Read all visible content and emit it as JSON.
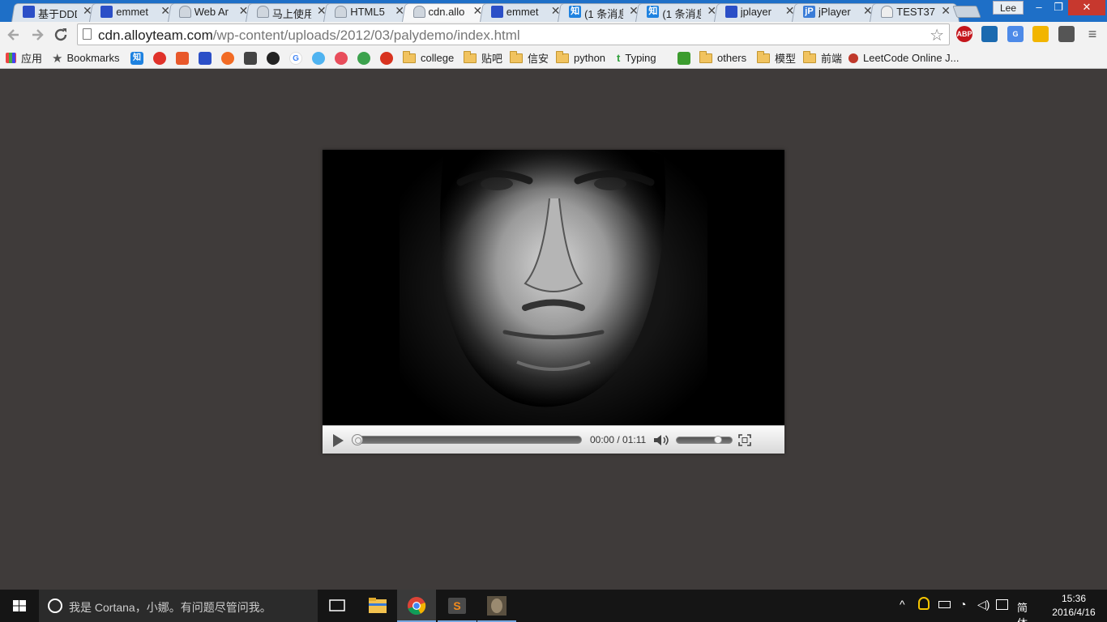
{
  "browser": {
    "tabs": [
      {
        "title": "基于DDD",
        "icon": "paw-icon",
        "active": false
      },
      {
        "title": "emmet",
        "icon": "paw-icon",
        "active": false
      },
      {
        "title": "Web Ar",
        "icon": "ghost-icon",
        "active": false
      },
      {
        "title": "马上使用",
        "icon": "ghost-icon",
        "active": false
      },
      {
        "title": "HTML5",
        "icon": "ghost-icon",
        "active": false
      },
      {
        "title": "cdn.allo",
        "icon": "ghost-icon",
        "active": true
      },
      {
        "title": "emmet",
        "icon": "paw-icon",
        "active": false
      },
      {
        "title": "(1 条消息",
        "icon": "zhihu-icon",
        "active": false
      },
      {
        "title": "(1 条消息",
        "icon": "zhihu-icon",
        "active": false
      },
      {
        "title": "jplayer",
        "icon": "paw-icon",
        "active": false
      },
      {
        "title": "jPlayer",
        "icon": "jp-icon",
        "active": false
      },
      {
        "title": "TEST37",
        "icon": "page-icon",
        "active": false
      }
    ],
    "user": "Lee",
    "window_controls": {
      "minimize": "–",
      "restore": "❐",
      "close": "✕"
    },
    "url_host": "cdn.alloyteam.com",
    "url_path": "/wp-content/uploads/2012/03/palydemo/index.html",
    "extensions": [
      "ABP"
    ]
  },
  "bookmarks": {
    "apps": "应用",
    "bookmarks": "Bookmarks",
    "zhihu": "知",
    "college": "college",
    "tieba": "贴吧",
    "xinan": "信安",
    "python": "python",
    "typing": "Typing",
    "others": "others",
    "moxing": "模型",
    "qianduan": "前端",
    "leetcode": "LeetCode Online J..."
  },
  "player": {
    "current_time": "00:00",
    "separator": " / ",
    "duration": "01:11",
    "progress": 0,
    "volume": 0.8
  },
  "taskbar": {
    "cortana_placeholder": "我是 Cortana，小娜。有问题尽管问我。",
    "ime": "简体",
    "time": "15:36",
    "date": "2016/4/16"
  }
}
